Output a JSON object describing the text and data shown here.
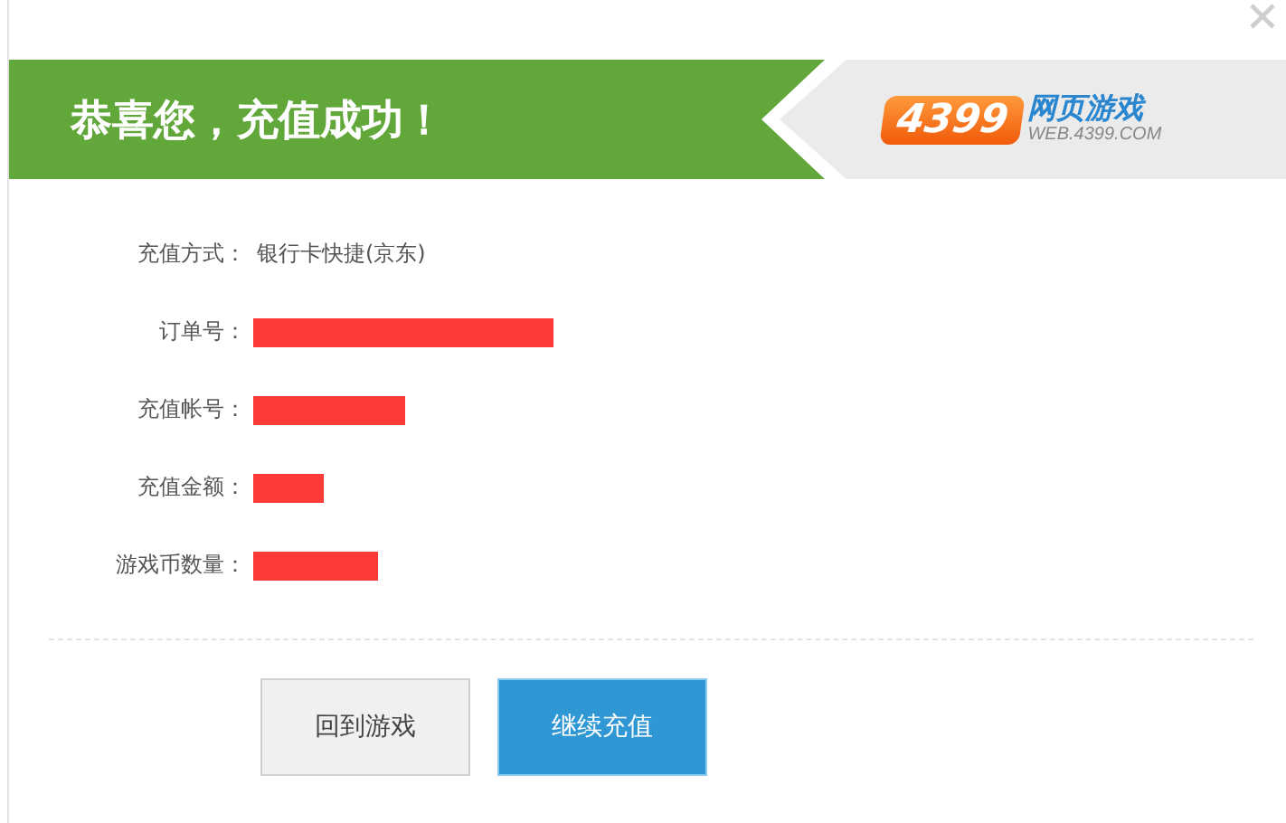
{
  "banner": {
    "title": "恭喜您，充值成功！",
    "logo": {
      "number": "4399",
      "name": "网页游戏",
      "site": "WEB.4399.COM"
    }
  },
  "details": [
    {
      "label": "充值方式：",
      "kind": "text",
      "value": "银行卡快捷(京东)"
    },
    {
      "label": "订单号：",
      "kind": "redacted"
    },
    {
      "label": "充值帐号：",
      "kind": "redacted"
    },
    {
      "label": "充值金额：",
      "kind": "redacted"
    },
    {
      "label": "游戏币数量：",
      "kind": "redacted"
    }
  ],
  "buttons": [
    {
      "label": "回到游戏",
      "kind": "secondary"
    },
    {
      "label": "继续充值",
      "kind": "primary"
    }
  ]
}
